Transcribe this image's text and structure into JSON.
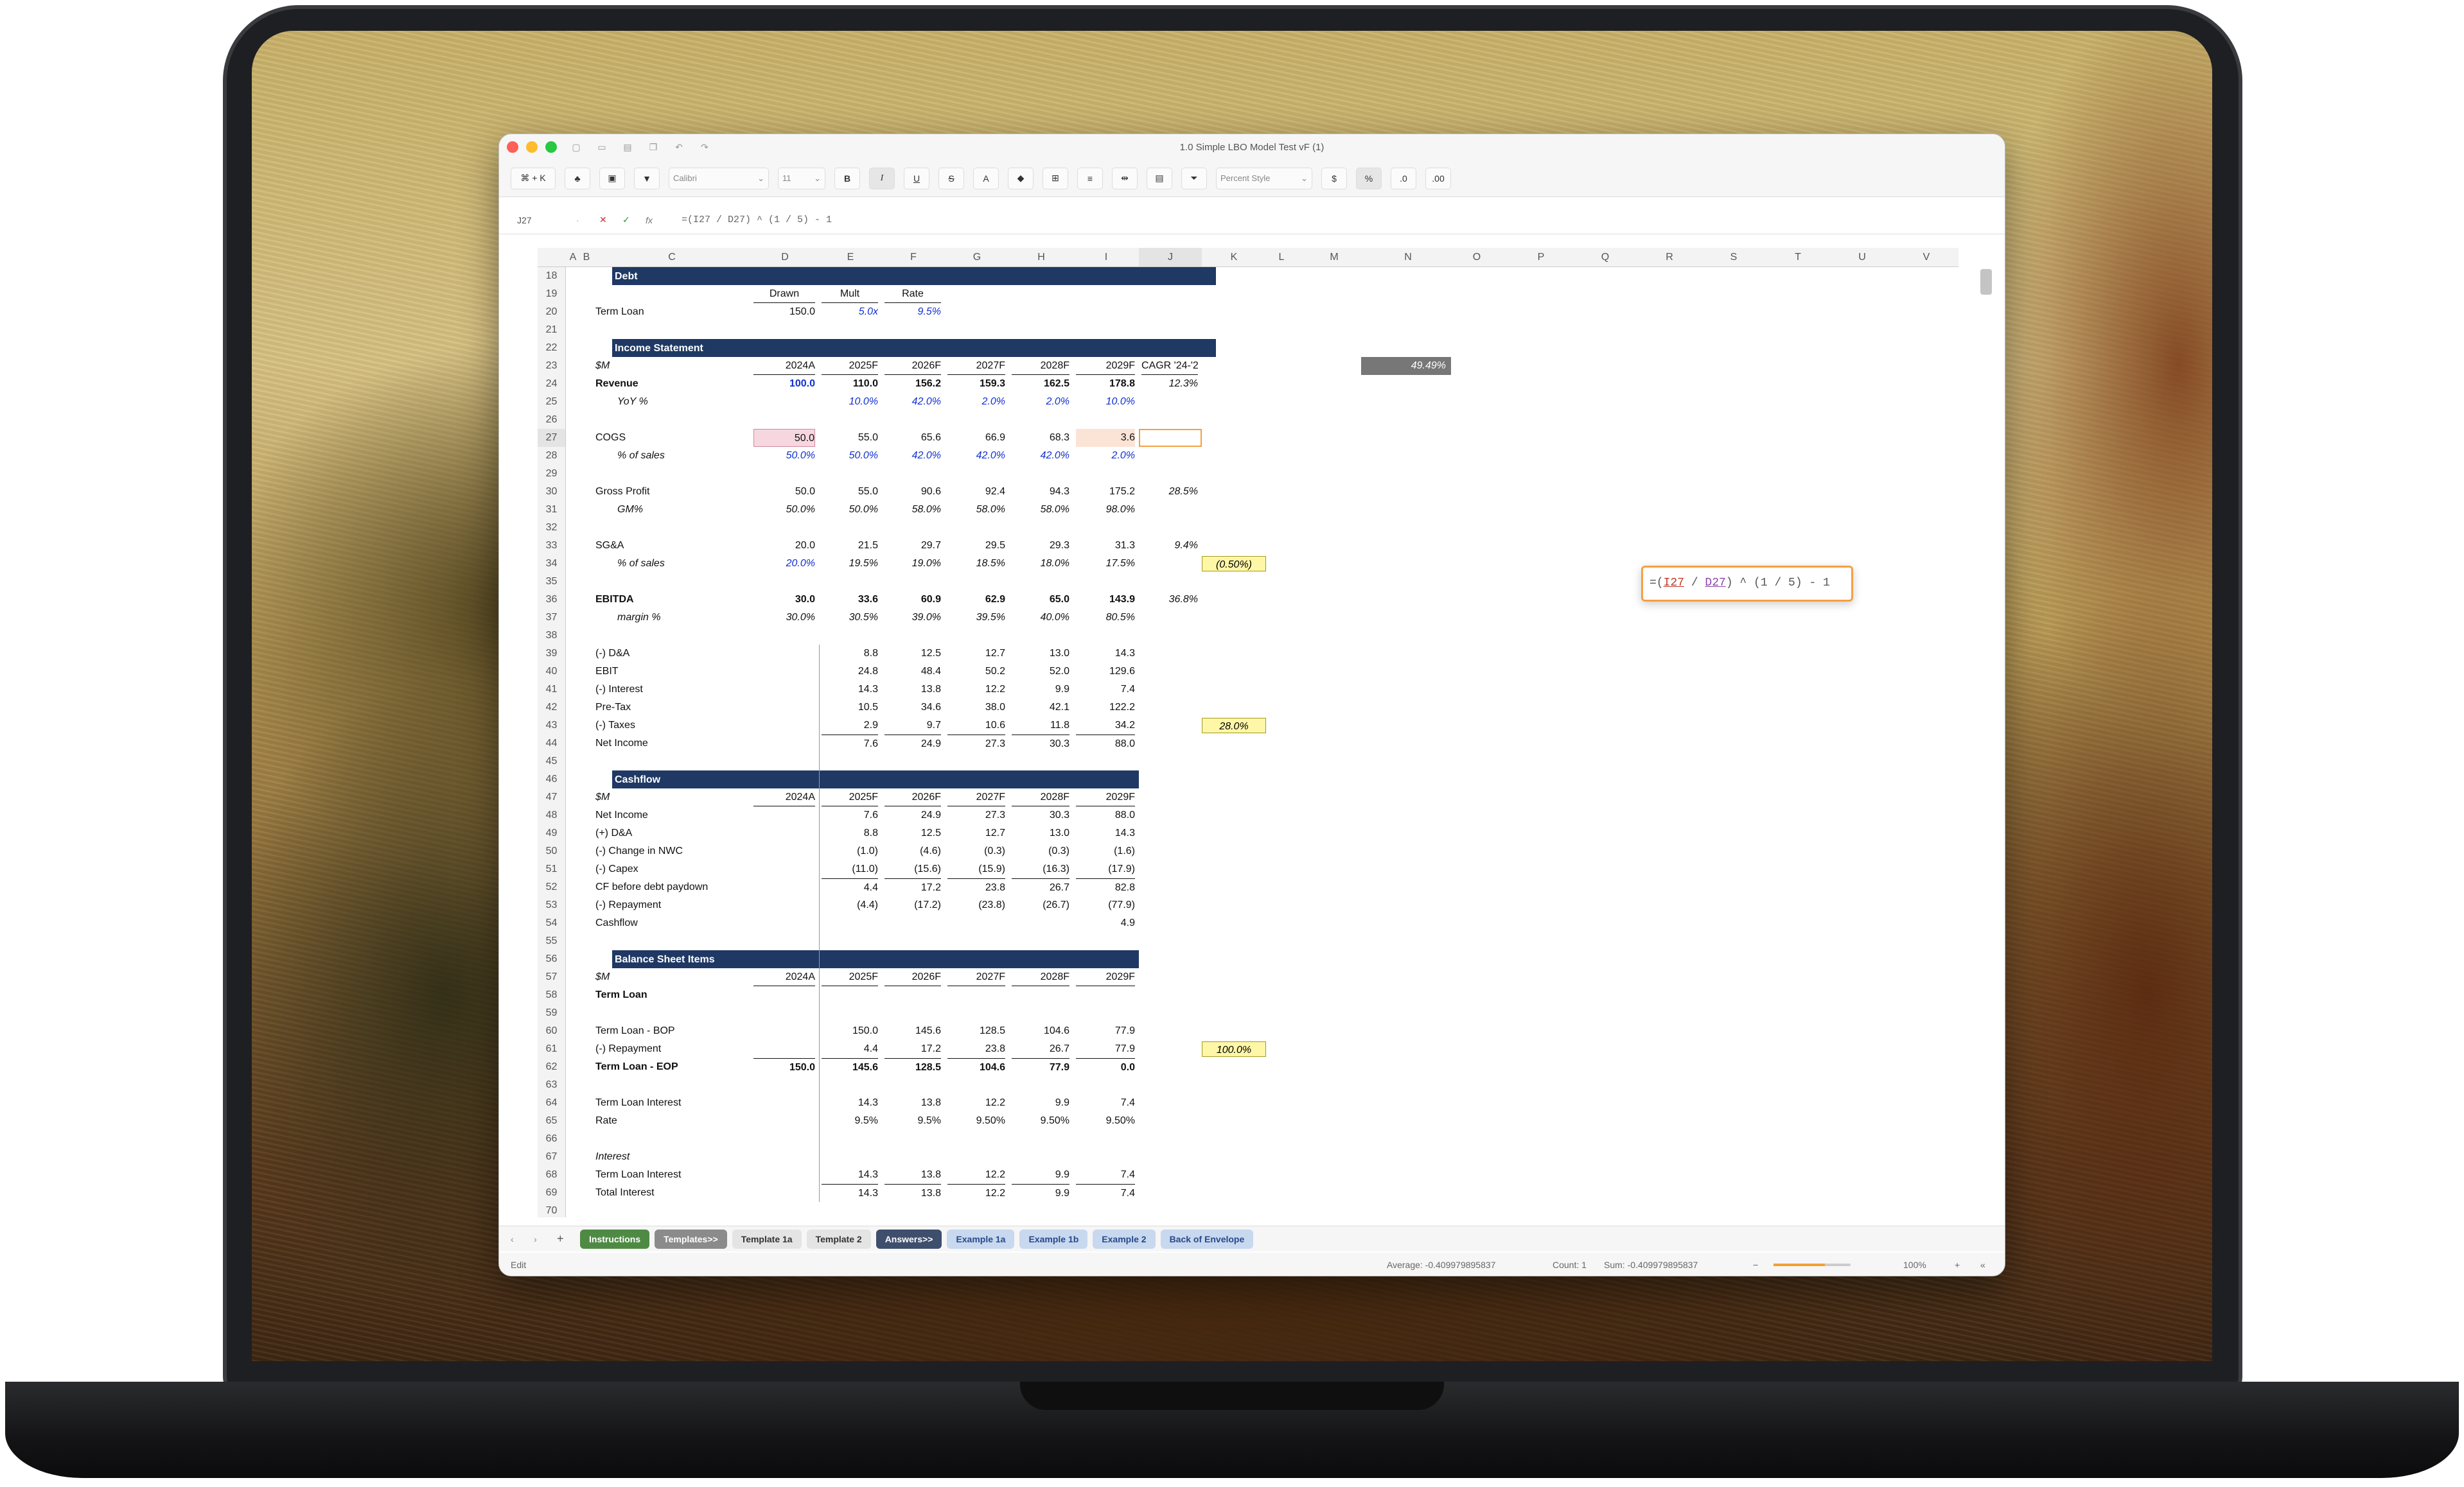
{
  "window": {
    "title": "1.0 Simple LBO Model Test vF (1)"
  },
  "toolbar": {
    "cmdk": "⌘ + K",
    "font": "Calibri",
    "size": "11",
    "bold": "B",
    "italic": "I",
    "underline": "U",
    "strike": "S",
    "style": "Percent Style"
  },
  "formula_bar": {
    "cell": "J27",
    "formula": "=(I27 / D27) ^ (1 / 5) - 1"
  },
  "columns": [
    "A",
    "B",
    "C",
    "D",
    "E",
    "F",
    "G",
    "H",
    "I",
    "J",
    "K",
    "L",
    "M",
    "N",
    "O",
    "P",
    "Q",
    "R",
    "S",
    "T",
    "U",
    "V"
  ],
  "rows": [
    "18",
    "19",
    "20",
    "21",
    "22",
    "23",
    "24",
    "25",
    "26",
    "27",
    "28",
    "29",
    "30",
    "31",
    "32",
    "33",
    "34",
    "35",
    "36",
    "37",
    "38",
    "39",
    "40",
    "41",
    "42",
    "43",
    "44",
    "45",
    "46",
    "47",
    "48",
    "49",
    "50",
    "51",
    "52",
    "53",
    "54",
    "55",
    "56",
    "57",
    "58",
    "59",
    "60",
    "61",
    "62",
    "63",
    "64",
    "65",
    "66",
    "67",
    "68",
    "69",
    "70"
  ],
  "sections": {
    "debt": "Debt",
    "income": "Income Statement",
    "cashflow": "Cashflow",
    "balance": "Balance Sheet Items"
  },
  "debt": {
    "h_drawn": "Drawn",
    "h_mult": "Mult",
    "h_rate": "Rate",
    "label": "Term Loan",
    "drawn": "150.0",
    "mult": "5.0x",
    "rate": "9.5%"
  },
  "income": {
    "unit": "$M",
    "years": [
      "2024A",
      "2025F",
      "2026F",
      "2027F",
      "2028F",
      "2029F"
    ],
    "cagr_hdr": "CAGR '24-'29",
    "lines": [
      {
        "label": "Revenue",
        "vals": [
          "100.0",
          "110.0",
          "156.2",
          "159.3",
          "162.5",
          "178.8"
        ],
        "cagr": "12.3%"
      },
      {
        "label": "YoY %",
        "vals": [
          "",
          "10.0%",
          "42.0%",
          "2.0%",
          "2.0%",
          "10.0%"
        ],
        "cagr": ""
      },
      {
        "label": "COGS",
        "vals": [
          "50.0",
          "55.0",
          "65.6",
          "66.9",
          "68.3",
          "3.6"
        ],
        "cagr": ""
      },
      {
        "label": "% of sales",
        "vals": [
          "50.0%",
          "50.0%",
          "42.0%",
          "42.0%",
          "42.0%",
          "2.0%"
        ],
        "cagr": ""
      },
      {
        "label": "Gross Profit",
        "vals": [
          "50.0",
          "55.0",
          "90.6",
          "92.4",
          "94.3",
          "175.2"
        ],
        "cagr": "28.5%"
      },
      {
        "label": "GM%",
        "vals": [
          "50.0%",
          "50.0%",
          "58.0%",
          "58.0%",
          "58.0%",
          "98.0%"
        ],
        "cagr": ""
      },
      {
        "label": "SG&A",
        "vals": [
          "20.0",
          "21.5",
          "29.7",
          "29.5",
          "29.3",
          "31.3"
        ],
        "cagr": "9.4%"
      },
      {
        "label": "% of sales",
        "vals": [
          "20.0%",
          "19.5%",
          "19.0%",
          "18.5%",
          "18.0%",
          "17.5%"
        ],
        "cagr": ""
      },
      {
        "label": "EBITDA",
        "vals": [
          "30.0",
          "33.6",
          "60.9",
          "62.9",
          "65.0",
          "143.9"
        ],
        "cagr": "36.8%"
      },
      {
        "label": "margin %",
        "vals": [
          "30.0%",
          "30.5%",
          "39.0%",
          "39.5%",
          "40.0%",
          "80.5%"
        ],
        "cagr": ""
      },
      {
        "label": "(-) D&A",
        "vals": [
          "",
          "8.8",
          "12.5",
          "12.7",
          "13.0",
          "14.3"
        ],
        "cagr": ""
      },
      {
        "label": "EBIT",
        "vals": [
          "",
          "24.8",
          "48.4",
          "50.2",
          "52.0",
          "129.6"
        ],
        "cagr": ""
      },
      {
        "label": "(-) Interest",
        "vals": [
          "",
          "14.3",
          "13.8",
          "12.2",
          "9.9",
          "7.4"
        ],
        "cagr": ""
      },
      {
        "label": "Pre-Tax",
        "vals": [
          "",
          "10.5",
          "34.6",
          "38.0",
          "42.1",
          "122.2"
        ],
        "cagr": ""
      },
      {
        "label": "(-) Taxes",
        "vals": [
          "",
          "2.9",
          "9.7",
          "10.6",
          "11.8",
          "34.2"
        ],
        "cagr": ""
      },
      {
        "label": "Net Income",
        "vals": [
          "",
          "7.6",
          "24.9",
          "27.3",
          "30.3",
          "88.0"
        ],
        "cagr": ""
      }
    ],
    "n23": "49.49%",
    "k34": "(0.50%)",
    "k43": "28.0%"
  },
  "cashflow": {
    "unit": "$M",
    "lines": [
      {
        "label": "Net Income",
        "vals": [
          "",
          "7.6",
          "24.9",
          "27.3",
          "30.3",
          "88.0"
        ]
      },
      {
        "label": "(+) D&A",
        "vals": [
          "",
          "8.8",
          "12.5",
          "12.7",
          "13.0",
          "14.3"
        ]
      },
      {
        "label": "(-) Change in NWC",
        "vals": [
          "",
          "(1.0)",
          "(4.6)",
          "(0.3)",
          "(0.3)",
          "(1.6)"
        ]
      },
      {
        "label": "(-) Capex",
        "vals": [
          "",
          "(11.0)",
          "(15.6)",
          "(15.9)",
          "(16.3)",
          "(17.9)"
        ]
      },
      {
        "label": "CF before debt paydown",
        "vals": [
          "",
          "4.4",
          "17.2",
          "23.8",
          "26.7",
          "82.8"
        ]
      },
      {
        "label": "(-) Repayment",
        "vals": [
          "",
          "(4.4)",
          "(17.2)",
          "(23.8)",
          "(26.7)",
          "(77.9)"
        ]
      },
      {
        "label": "Cashflow",
        "vals": [
          "",
          "",
          "",
          "",
          "",
          "4.9"
        ]
      }
    ]
  },
  "balance": {
    "unit": "$M",
    "term_loan": "Term Loan",
    "lines": [
      {
        "row": "60",
        "label": "Term Loan - BOP",
        "vals": [
          "",
          "150.0",
          "145.6",
          "128.5",
          "104.6",
          "77.9"
        ]
      },
      {
        "row": "61",
        "label": "(-) Repayment",
        "vals": [
          "",
          "4.4",
          "17.2",
          "23.8",
          "26.7",
          "77.9"
        ]
      },
      {
        "row": "62",
        "label": "Term Loan - EOP",
        "vals": [
          "150.0",
          "145.6",
          "128.5",
          "104.6",
          "77.9",
          "0.0"
        ]
      },
      {
        "row": "64",
        "label": "Term Loan Interest",
        "vals": [
          "",
          "14.3",
          "13.8",
          "12.2",
          "9.9",
          "7.4"
        ]
      },
      {
        "row": "65",
        "label": "Rate",
        "vals": [
          "",
          "9.5%",
          "9.5%",
          "9.50%",
          "9.50%",
          "9.50%"
        ]
      },
      {
        "row": "67",
        "label": "Interest",
        "vals": [
          "",
          "",
          "",
          "",
          "",
          ""
        ]
      },
      {
        "row": "68",
        "label": "Term Loan Interest",
        "vals": [
          "",
          "14.3",
          "13.8",
          "12.2",
          "9.9",
          "7.4"
        ]
      },
      {
        "row": "69",
        "label": "Total Interest",
        "vals": [
          "",
          "14.3",
          "13.8",
          "12.2",
          "9.9",
          "7.4"
        ]
      }
    ],
    "k61": "100.0%"
  },
  "tabs": [
    {
      "label": "Instructions",
      "bg": "#4f8a45",
      "fg": "#fff"
    },
    {
      "label": "Templates>>",
      "bg": "#8b8b8b",
      "fg": "#fff"
    },
    {
      "label": "Template 1a",
      "bg": "#e4e4e4",
      "fg": "#333"
    },
    {
      "label": "Template 2",
      "bg": "#e4e4e4",
      "fg": "#333"
    },
    {
      "label": "Answers>>",
      "bg": "#3e4e6d",
      "fg": "#fff"
    },
    {
      "label": "Example 1a",
      "bg": "#c8d8ef",
      "fg": "#264a8a"
    },
    {
      "label": "Example 1b",
      "bg": "#c8d8ef",
      "fg": "#264a8a"
    },
    {
      "label": "Example 2",
      "bg": "#c8d8ef",
      "fg": "#264a8a"
    },
    {
      "label": "Back of Envelope",
      "bg": "#c8d8ef",
      "fg": "#264a8a"
    }
  ],
  "status": {
    "mode": "Edit",
    "average": "Average: -0.409979895837",
    "count": "Count: 1",
    "sum": "Sum: -0.409979895837",
    "zoom": "100%"
  }
}
